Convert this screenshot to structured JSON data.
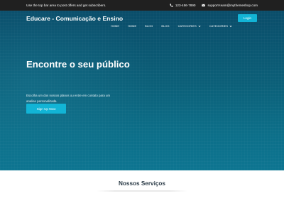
{
  "topbar": {
    "promo_text": "Use the top bar area to post offers and get subscribers.",
    "phone": "123-456-7890",
    "email": "support-team@mythemeshop.com",
    "phone_icon": "phone-icon",
    "email_icon": "envelope-icon"
  },
  "header": {
    "brand": "Educare - Comunicação e Ensino",
    "login_label": "Login",
    "nav": [
      {
        "label": "HOME"
      },
      {
        "label": "HOME"
      },
      {
        "label": "BLOG"
      },
      {
        "label": "BLOG"
      },
      {
        "label": "CATEGORIES",
        "icon": "chevron-down-icon"
      },
      {
        "label": "CATEGORIES",
        "icon": "chevron-down-icon"
      }
    ]
  },
  "hero": {
    "title": "Encontre o seu público",
    "text": "Escolha um dos nossos planos ou entre em contato para um analise personalizada",
    "cta_label": "Sign Up Now"
  },
  "services": {
    "title": "Nossos Serviços"
  },
  "colors": {
    "topbar_bg": "#202020",
    "hero_bg": "#0b5f78",
    "accent": "#12b4d6"
  }
}
